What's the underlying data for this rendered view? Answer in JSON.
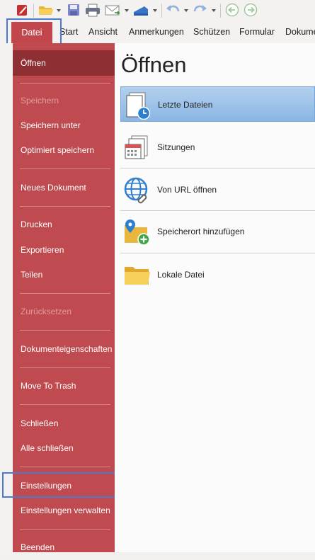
{
  "toolbar": {
    "icons": [
      "app-logo-icon",
      "open-folder-icon",
      "save-icon",
      "print-icon",
      "email-icon",
      "scanner-icon",
      "undo-icon",
      "redo-icon",
      "back-icon",
      "forward-icon"
    ]
  },
  "menubar": {
    "tabs": [
      {
        "label": "Datei",
        "active": true
      },
      {
        "label": "Start"
      },
      {
        "label": "Ansicht"
      },
      {
        "label": "Anmerkungen"
      },
      {
        "label": "Schützen"
      },
      {
        "label": "Formular"
      },
      {
        "label": "Dokume"
      }
    ]
  },
  "sidebar": {
    "items": [
      {
        "label": "Öffnen",
        "state": "active"
      },
      {
        "label": "Speichern",
        "state": "disabled"
      },
      {
        "label": "Speichern unter"
      },
      {
        "label": "Optimiert speichern"
      },
      {
        "label": "Neues Dokument"
      },
      {
        "label": "Drucken"
      },
      {
        "label": "Exportieren"
      },
      {
        "label": "Teilen"
      },
      {
        "label": "Zurücksetzen",
        "state": "disabled"
      },
      {
        "label": "Dokumenteigenschaften"
      },
      {
        "label": "Move To Trash"
      },
      {
        "label": "Schließen"
      },
      {
        "label": "Alle schließen"
      },
      {
        "label": "Einstellungen"
      },
      {
        "label": "Einstellungen verwalten"
      },
      {
        "label": "Beenden"
      }
    ]
  },
  "main": {
    "title": "Öffnen",
    "options": [
      {
        "label": "Letzte Dateien",
        "icon": "recent-files-icon",
        "selected": true
      },
      {
        "label": "Sitzungen",
        "icon": "sessions-icon"
      },
      {
        "label": "Von URL öffnen",
        "icon": "globe-link-icon"
      },
      {
        "label": "Speicherort hinzufügen",
        "icon": "add-location-icon"
      },
      {
        "label": "Lokale Datei",
        "icon": "folder-icon"
      }
    ]
  },
  "colors": {
    "sidebar": "#bf4b50",
    "sidebar_active": "#8e2f33",
    "highlight_border": "#4a7bd0",
    "selected_option": "#9cc2ea"
  }
}
